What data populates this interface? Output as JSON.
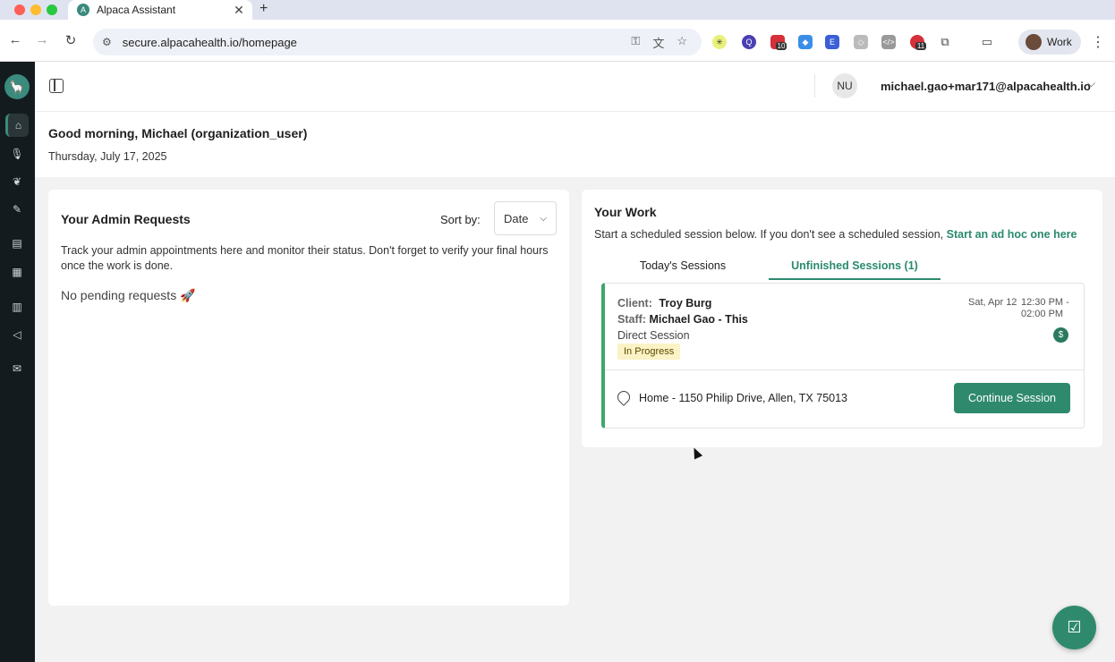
{
  "browser": {
    "tab_title": "Alpaca Assistant",
    "tab_close": "✕",
    "new_tab": "+",
    "url": "secure.alpacahealth.io/homepage",
    "profile_label": "Work",
    "extension_badges": [
      "10",
      "11"
    ],
    "nav_icons": [
      "back-icon",
      "forward-icon",
      "reload-icon"
    ]
  },
  "app": {
    "logo_icon": "alpaca-logo",
    "rail_items": [
      "home-icon",
      "microphone-icon",
      "brain-icon",
      "pen-icon",
      "documents-icon",
      "calendar-icon",
      "clipboard-icon",
      "megaphone-icon",
      "mail-icon"
    ],
    "user": {
      "initials": "NU",
      "email": "michael.gao+mar171@alpacahealth.io"
    },
    "greeting": "Good morning, Michael (organization_user)",
    "date": "Thursday, July 17, 2025"
  },
  "admin": {
    "title": "Your Admin Requests",
    "sort_label": "Sort by:",
    "sort_value": "Date",
    "description": "Track your admin appointments here and monitor their status. Don't forget to verify your final hours once the work is done.",
    "empty_text": "No pending requests 🚀"
  },
  "work": {
    "title": "Your Work",
    "description": "Start a scheduled session below. If you don't see a scheduled session,",
    "adhoc_link": "Start an ad hoc one here",
    "tabs": [
      "Today's Sessions",
      "Unfinished Sessions (1)"
    ],
    "session": {
      "client_label": "Client:",
      "client": "Troy Burg",
      "staff_label": "Staff:",
      "staff": "Michael Gao - This",
      "type": "Direct Session",
      "status": "In Progress",
      "date": "Sat, Apr 12",
      "time": "12:30 PM - 02:00 PM",
      "billing_symbol": "$",
      "address": "Home - 1150 Philip Drive, Allen, TX 75013",
      "action": "Continue Session"
    }
  },
  "colors": {
    "accent": "#2f8a6d",
    "rail": "#141b1e",
    "badge": "#fbf2c6"
  }
}
